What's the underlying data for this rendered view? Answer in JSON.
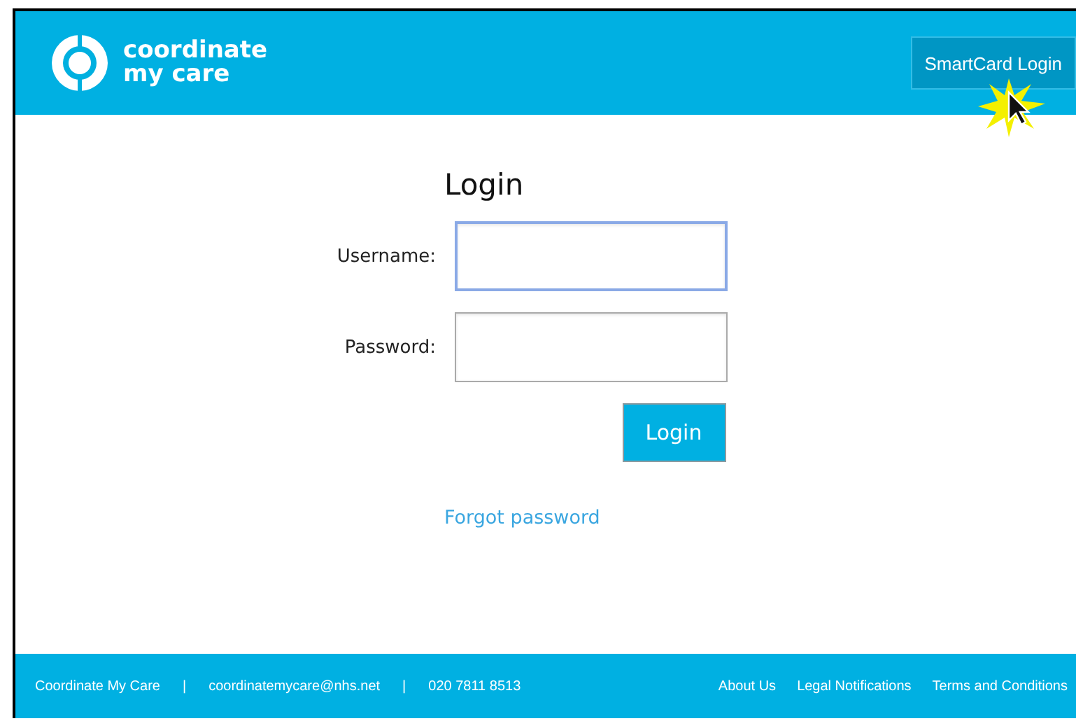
{
  "header": {
    "logo_line_1": "coordinate",
    "logo_line_2": "my care",
    "smartcard_button": "SmartCard Login"
  },
  "login": {
    "title": "Login",
    "fields": [
      {
        "label": "Username:",
        "focused": true
      },
      {
        "label": "Password:",
        "focused": false
      }
    ],
    "submit": "Login",
    "forgot_link": "Forgot password"
  },
  "footer": {
    "left": [
      "Coordinate My Care",
      "coordinatemycare@nhs.net",
      "020 7811 8513"
    ],
    "separator": "|",
    "links": [
      "About Us",
      "Legal Notifications",
      "Terms and Conditions"
    ]
  }
}
